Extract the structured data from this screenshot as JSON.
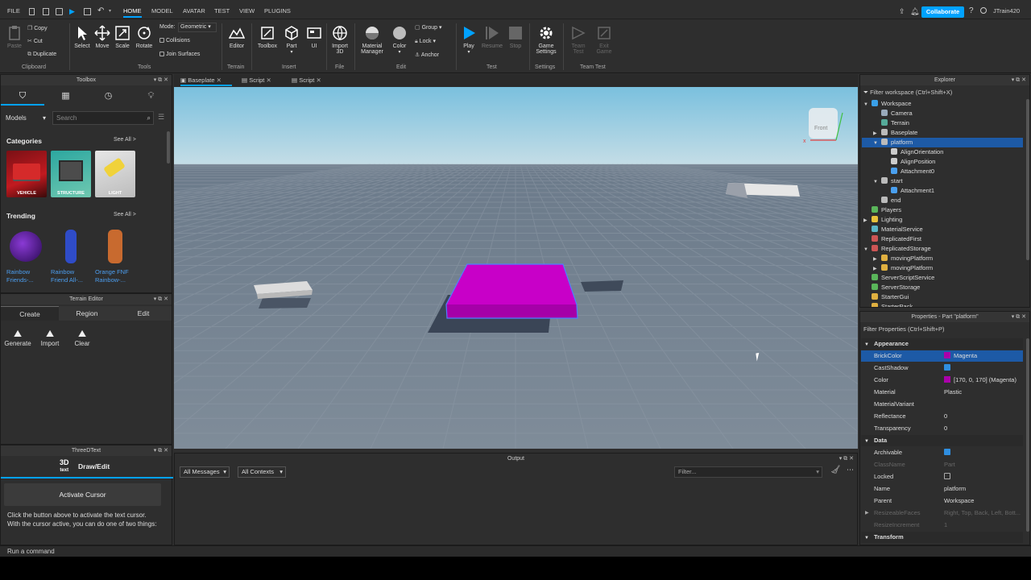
{
  "menubar": {
    "file": "FILE",
    "tabs": [
      "HOME",
      "MODEL",
      "AVATAR",
      "TEST",
      "VIEW",
      "PLUGINS"
    ],
    "active_tab": "HOME",
    "collaborate": "Collaborate",
    "username": "JTrain420"
  },
  "ribbon": {
    "clipboard": {
      "paste": "Paste",
      "copy": "Copy",
      "cut": "Cut",
      "duplicate": "Duplicate",
      "label": "Clipboard"
    },
    "tools": {
      "select": "Select",
      "move": "Move",
      "scale": "Scale",
      "rotate": "Rotate",
      "mode_label": "Mode:",
      "mode_value": "Geometric",
      "collisions": "Collisions",
      "join_surfaces": "Join Surfaces",
      "label": "Tools"
    },
    "terrain": {
      "editor": "Editor",
      "label": "Terrain"
    },
    "insert": {
      "toolbox": "Toolbox",
      "part": "Part",
      "ui": "UI",
      "label": "Insert"
    },
    "file": {
      "import3d_1": "Import",
      "import3d_2": "3D",
      "label": "File"
    },
    "edit": {
      "material_1": "Material",
      "material_2": "Manager",
      "color": "Color",
      "group": "Group",
      "lock": "Lock",
      "anchor": "Anchor",
      "label": "Edit"
    },
    "test": {
      "play": "Play",
      "resume": "Resume",
      "stop": "Stop",
      "label": "Test"
    },
    "settings": {
      "game_1": "Game",
      "game_2": "Settings",
      "label": "Settings"
    },
    "teamtest": {
      "team_1": "Team",
      "team_2": "Test",
      "exit_1": "Exit",
      "exit_2": "Game",
      "label": "Team Test"
    }
  },
  "toolbox": {
    "title": "Toolbox",
    "dropdown": "Models",
    "search_placeholder": "Search",
    "categories_title": "Categories",
    "see_all": "See All >",
    "categories": [
      "VEHICLE",
      "STRUCTURE",
      "LIGHT"
    ],
    "trending_title": "Trending",
    "trending_see_all": "See All >",
    "trending": [
      [
        "Rainbow",
        "Friends-..."
      ],
      [
        "Rainbow",
        "Friend All-..."
      ],
      [
        "Orange FNF",
        "Rainbow-..."
      ]
    ]
  },
  "terrain_editor": {
    "title": "Terrain Editor",
    "tabs": [
      "Create",
      "Region",
      "Edit"
    ],
    "tools": [
      "Generate",
      "Import",
      "Clear"
    ]
  },
  "threedtext": {
    "title": "ThreeDText",
    "logo_3d": "3D",
    "logo_text": "text",
    "mode": "Draw/Edit",
    "button": "Activate Cursor",
    "desc": "Click the button above to activate the text cursor. With the cursor active, you can do one of two things:"
  },
  "doc_tabs": [
    "Baseplate",
    "Script",
    "Script"
  ],
  "viewport": {
    "cube_label": "Front",
    "axis_x": "x"
  },
  "output": {
    "title": "Output",
    "messages": "All Messages",
    "contexts": "All Contexts",
    "filter": "Filter..."
  },
  "explorer": {
    "title": "Explorer",
    "filter": "Filter workspace (Ctrl+Shift+X)",
    "items": [
      {
        "label": "Workspace",
        "depth": 1,
        "arrow": "▼",
        "color": "#3aa0e8"
      },
      {
        "label": "Camera",
        "depth": 2,
        "arrow": "",
        "color": "#9ab"
      },
      {
        "label": "Terrain",
        "depth": 2,
        "arrow": "",
        "color": "#5a9"
      },
      {
        "label": "Baseplate",
        "depth": 2,
        "arrow": "▶",
        "color": "#bbb"
      },
      {
        "label": "platform",
        "depth": 2,
        "arrow": "▼",
        "color": "#bbb",
        "selected": true
      },
      {
        "label": "AlignOrientation",
        "depth": 3,
        "arrow": "",
        "color": "#ccc"
      },
      {
        "label": "AlignPosition",
        "depth": 3,
        "arrow": "",
        "color": "#ccc"
      },
      {
        "label": "Attachment0",
        "depth": 3,
        "arrow": "",
        "color": "#4aa0f0"
      },
      {
        "label": "start",
        "depth": 2,
        "arrow": "▼",
        "color": "#bbb"
      },
      {
        "label": "Attachment1",
        "depth": 3,
        "arrow": "",
        "color": "#4aa0f0"
      },
      {
        "label": "end",
        "depth": 2,
        "arrow": "",
        "color": "#bbb"
      },
      {
        "label": "Players",
        "depth": 1,
        "arrow": "",
        "color": "#5ab55a"
      },
      {
        "label": "Lighting",
        "depth": 1,
        "arrow": "▶",
        "color": "#e8c23a"
      },
      {
        "label": "MaterialService",
        "depth": 1,
        "arrow": "",
        "color": "#5ab5c5"
      },
      {
        "label": "ReplicatedFirst",
        "depth": 1,
        "arrow": "",
        "color": "#c55"
      },
      {
        "label": "ReplicatedStorage",
        "depth": 1,
        "arrow": "▼",
        "color": "#c55"
      },
      {
        "label": "movingPlatform",
        "depth": 2,
        "arrow": "▶",
        "color": "#e0b040"
      },
      {
        "label": "movingPlatform",
        "depth": 2,
        "arrow": "▶",
        "color": "#e0b040"
      },
      {
        "label": "ServerScriptService",
        "depth": 1,
        "arrow": "",
        "color": "#5ab55a"
      },
      {
        "label": "ServerStorage",
        "depth": 1,
        "arrow": "",
        "color": "#5ab55a"
      },
      {
        "label": "StarterGui",
        "depth": 1,
        "arrow": "",
        "color": "#e0b040"
      },
      {
        "label": "StarterPack",
        "depth": 1,
        "arrow": "",
        "color": "#e0b040"
      }
    ]
  },
  "properties": {
    "title": "Properties - Part \"platform\"",
    "filter": "Filter Properties (Ctrl+Shift+P)",
    "rows": [
      {
        "kind": "section",
        "name": "Appearance"
      },
      {
        "kind": "row",
        "name": "BrickColor",
        "value": "Magenta",
        "swatch": "#aa00aa",
        "selected": true
      },
      {
        "kind": "row",
        "name": "CastShadow",
        "check": true
      },
      {
        "kind": "row",
        "name": "Color",
        "value": "[170, 0, 170] (Magenta)",
        "swatch": "#aa00aa"
      },
      {
        "kind": "row",
        "name": "Material",
        "value": "Plastic"
      },
      {
        "kind": "row",
        "name": "MaterialVariant",
        "value": ""
      },
      {
        "kind": "row",
        "name": "Reflectance",
        "value": "0"
      },
      {
        "kind": "row",
        "name": "Transparency",
        "value": "0"
      },
      {
        "kind": "section",
        "name": "Data"
      },
      {
        "kind": "row",
        "name": "Archivable",
        "check": true
      },
      {
        "kind": "row",
        "name": "ClassName",
        "value": "Part",
        "dim": true
      },
      {
        "kind": "row",
        "name": "Locked",
        "check": false
      },
      {
        "kind": "row",
        "name": "Name",
        "value": "platform"
      },
      {
        "kind": "row",
        "name": "Parent",
        "value": "Workspace"
      },
      {
        "kind": "row",
        "name": "ResizeableFaces",
        "value": "Right, Top, Back, Left, Bott...",
        "dim": true,
        "arrow": true
      },
      {
        "kind": "row",
        "name": "ResizeIncrement",
        "value": "1",
        "dim": true
      },
      {
        "kind": "section",
        "name": "Transform"
      }
    ]
  },
  "command_bar": {
    "placeholder": "Run a command"
  },
  "colors": {
    "accent": "#00a2ff",
    "magenta": "#aa00aa",
    "selection": "#1d5aa6"
  }
}
